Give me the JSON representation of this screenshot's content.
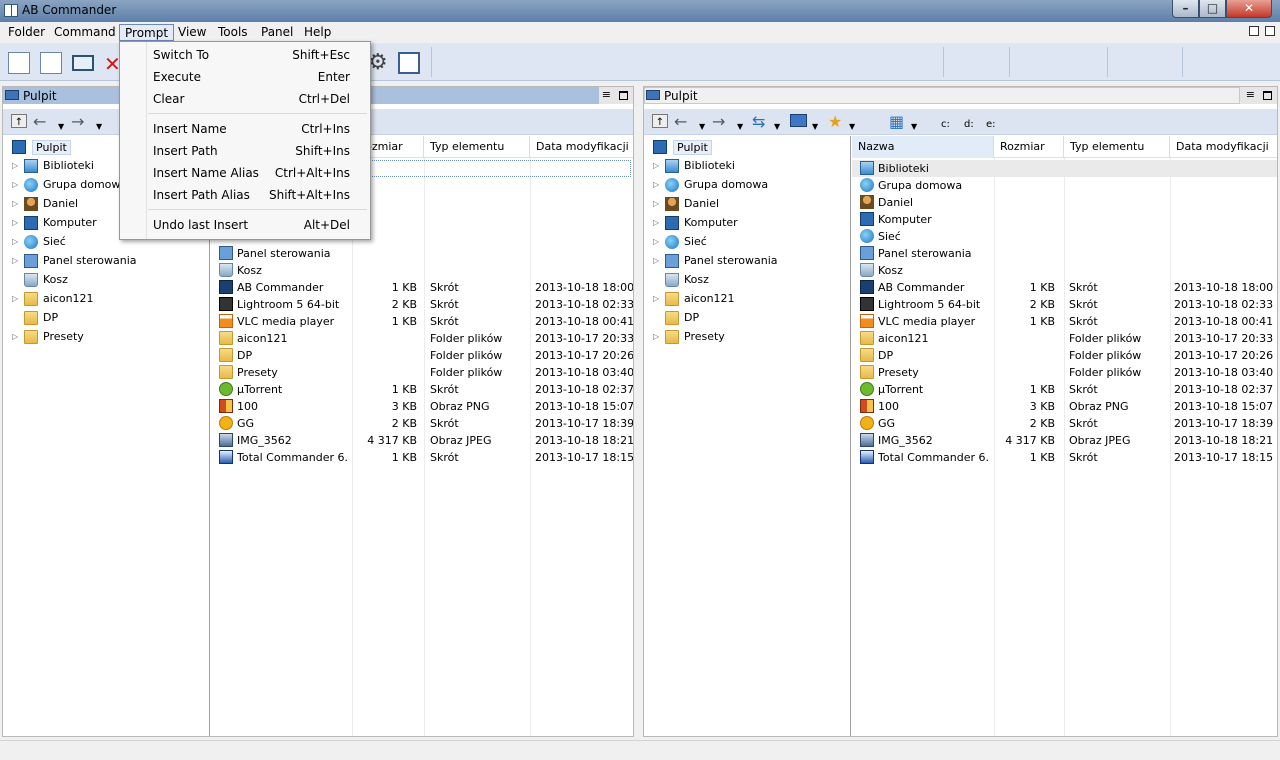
{
  "window": {
    "title": "AB Commander"
  },
  "menubar": {
    "items": [
      "Folder",
      "Command",
      "Prompt",
      "View",
      "Tools",
      "Panel",
      "Help"
    ],
    "active": "Prompt"
  },
  "prompt_menu": {
    "groups": [
      [
        {
          "label": "Switch To",
          "shortcut": "Shift+Esc"
        },
        {
          "label": "Execute",
          "shortcut": "Enter"
        },
        {
          "label": "Clear",
          "shortcut": "Ctrl+Del"
        }
      ],
      [
        {
          "label": "Insert Name",
          "shortcut": "Ctrl+Ins"
        },
        {
          "label": "Insert Path",
          "shortcut": "Shift+Ins"
        },
        {
          "label": "Insert Name Alias",
          "shortcut": "Ctrl+Alt+Ins"
        },
        {
          "label": "Insert Path Alias",
          "shortcut": "Shift+Alt+Ins"
        }
      ],
      [
        {
          "label": "Undo last Insert",
          "shortcut": "Alt+Del"
        }
      ]
    ]
  },
  "drives": [
    "c:",
    "d:",
    "e:"
  ],
  "panels": {
    "left": {
      "title": "Pulpit"
    },
    "right": {
      "title": "Pulpit"
    }
  },
  "tree": {
    "root": "Pulpit",
    "items": [
      {
        "label": "Biblioteki",
        "icon": "lib"
      },
      {
        "label": "Grupa domowa",
        "icon": "globe"
      },
      {
        "label": "Daniel",
        "icon": "user"
      },
      {
        "label": "Komputer",
        "icon": "monitor"
      },
      {
        "label": "Sieć",
        "icon": "globe"
      },
      {
        "label": "Panel sterowania",
        "icon": "cp"
      },
      {
        "label": "Kosz",
        "icon": "bin",
        "leaf": true
      },
      {
        "label": "aicon121",
        "icon": "folder"
      },
      {
        "label": "DP",
        "icon": "folder",
        "leaf": true
      },
      {
        "label": "Presety",
        "icon": "folder"
      }
    ]
  },
  "columns": [
    "Nazwa",
    "Rozmiar",
    "Typ elementu",
    "Data modyfikacji"
  ],
  "left_columns": [
    "Rozmiar",
    "Typ elementu",
    "Data modyfikacji"
  ],
  "files": [
    {
      "name": "Biblioteki",
      "size": "",
      "type": "",
      "date": "",
      "icon": "lib"
    },
    {
      "name": "Grupa domowa",
      "size": "",
      "type": "",
      "date": "",
      "icon": "globe"
    },
    {
      "name": "Daniel",
      "size": "",
      "type": "",
      "date": "",
      "icon": "user"
    },
    {
      "name": "Komputer",
      "size": "",
      "type": "",
      "date": "",
      "icon": "monitor"
    },
    {
      "name": "Sieć",
      "size": "",
      "type": "",
      "date": "",
      "icon": "globe"
    },
    {
      "name": "Panel sterowania",
      "size": "",
      "type": "",
      "date": "",
      "icon": "cp"
    },
    {
      "name": "Kosz",
      "size": "",
      "type": "",
      "date": "",
      "icon": "bin"
    },
    {
      "name": "AB Commander",
      "size": "1 KB",
      "type": "Skrót",
      "date": "2013-10-18 18:00",
      "icon": "short"
    },
    {
      "name": "Lightroom 5 64-bit",
      "size": "2 KB",
      "type": "Skrót",
      "date": "2013-10-18 02:33",
      "icon": "lr"
    },
    {
      "name": "VLC media player",
      "size": "1 KB",
      "type": "Skrót",
      "date": "2013-10-18 00:41",
      "icon": "vlc"
    },
    {
      "name": "aicon121",
      "size": "",
      "type": "Folder plików",
      "date": "2013-10-17 20:33",
      "icon": "folder"
    },
    {
      "name": "DP",
      "size": "",
      "type": "Folder plików",
      "date": "2013-10-17 20:26",
      "icon": "folder"
    },
    {
      "name": "Presety",
      "size": "",
      "type": "Folder plików",
      "date": "2013-10-18 03:40",
      "icon": "folder"
    },
    {
      "name": "µTorrent",
      "size": "1 KB",
      "type": "Skrót",
      "date": "2013-10-18 02:37",
      "icon": "torrent"
    },
    {
      "name": "100",
      "size": "3 KB",
      "type": "Obraz PNG",
      "date": "2013-10-18 15:07",
      "icon": "png"
    },
    {
      "name": "GG",
      "size": "2 KB",
      "type": "Skrót",
      "date": "2013-10-17 18:39",
      "icon": "gg"
    },
    {
      "name": "IMG_3562",
      "size": "4 317 KB",
      "type": "Obraz JPEG",
      "date": "2013-10-18 18:21",
      "icon": "jpeg"
    },
    {
      "name": "Total Commander 6...",
      "size": "1 KB",
      "type": "Skrót",
      "date": "2013-10-17 18:15",
      "icon": "tc"
    }
  ]
}
